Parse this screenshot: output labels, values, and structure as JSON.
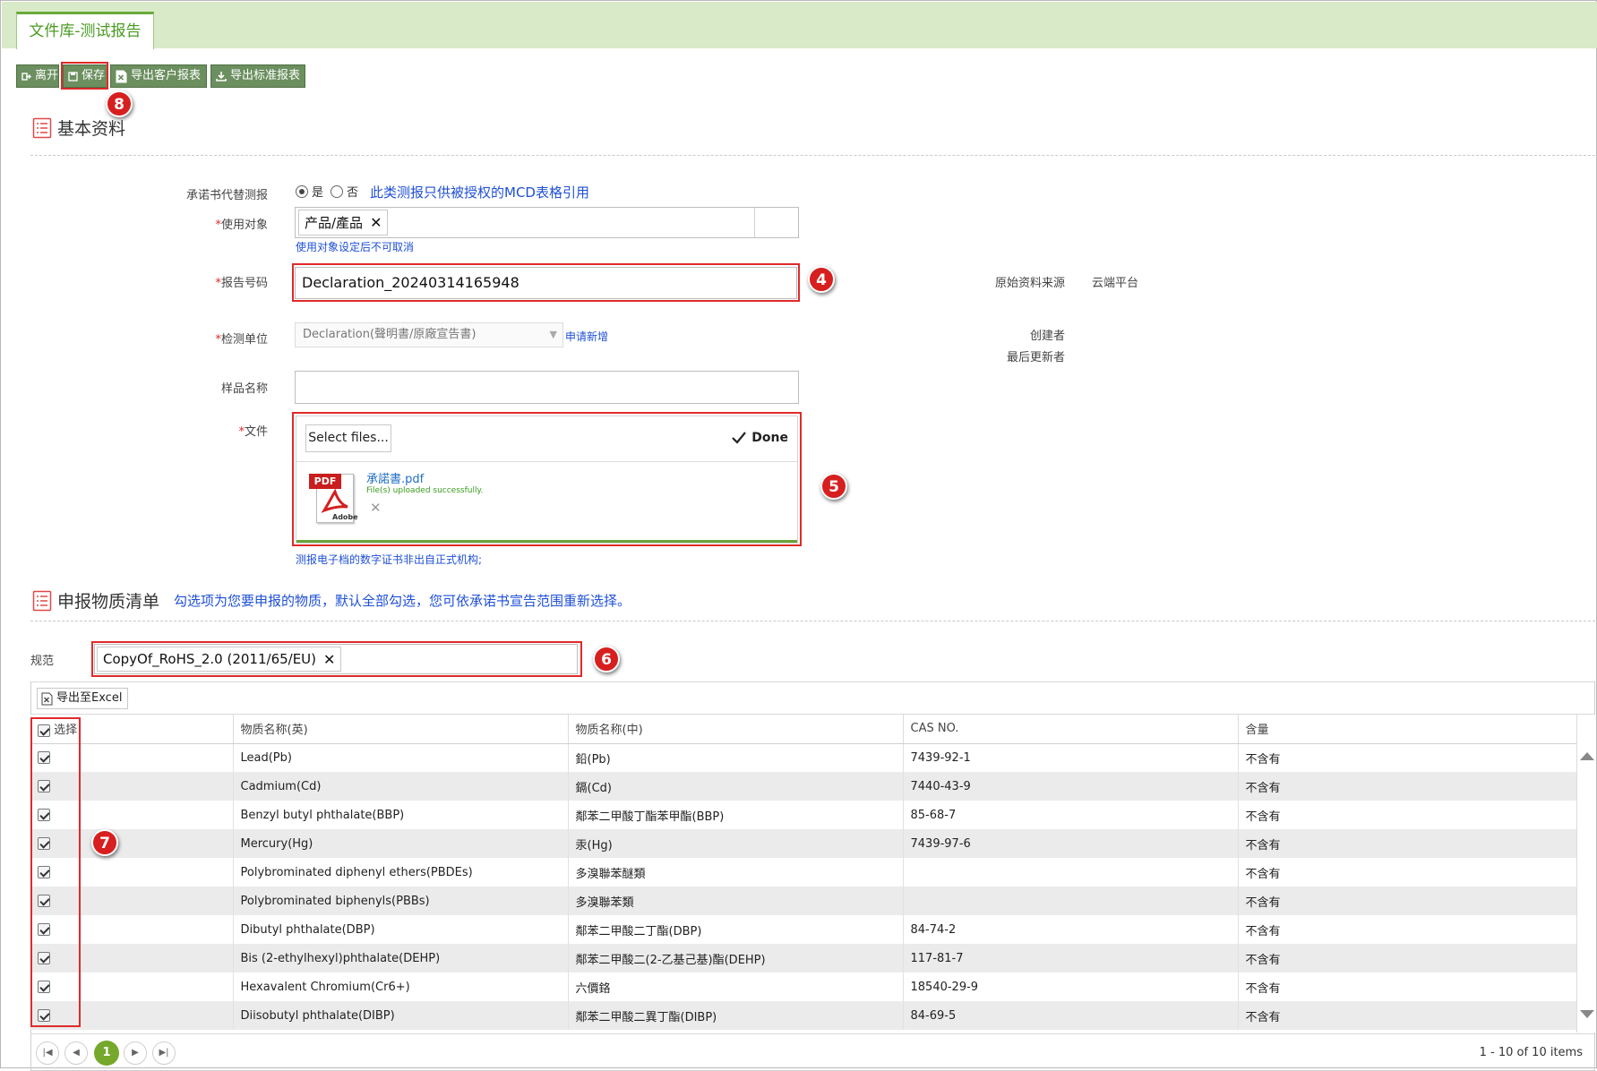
{
  "tab": {
    "title": "文件库-测试报告"
  },
  "toolbar": {
    "leave": "离开",
    "save": "保存",
    "export_customer": "导出客户报表",
    "export_standard": "导出标准报表"
  },
  "markers": {
    "m8": "8",
    "m4": "4",
    "m5": "5",
    "m6": "6",
    "m7": "7"
  },
  "section_basic": {
    "title": "基本资料"
  },
  "form": {
    "commitment_label": "承诺书代替测报",
    "radio_yes": "是",
    "radio_no": "否",
    "commitment_note": "此类测报只供被授权的MCD表格引用",
    "target_label": "使用对象",
    "target_chip": "产品/產品",
    "target_note": "使用对象设定后不可取消",
    "report_no_label": "报告号码",
    "report_no_value": "Declaration_20240314165948",
    "lab_label": "检测单位",
    "lab_value": "Declaration(聲明書/原廠宣告書)",
    "lab_apply": "申请新增",
    "sample_label": "样品名称",
    "sample_value": "",
    "file_label": "文件",
    "select_files": "Select files...",
    "done": "Done",
    "file_name": "承諾書.pdf",
    "file_status": "File(s) uploaded successfully.",
    "pdf_badge": "PDF",
    "pdf_brand": "Adobe",
    "file_note": "测报电子档的数字证书非出自正式机构;",
    "source_label": "原始资料来源",
    "source_value": "云端平台",
    "creator_label": "创建者",
    "updater_label": "最后更新者"
  },
  "section_substances": {
    "title": "申报物质清单",
    "hint": "勾选项为您要申报的物质，默认全部勾选，您可依承诺书宣告范围重新选择。"
  },
  "regulation": {
    "label": "规范",
    "chip": "CopyOf_RoHS_2.0 (2011/65/EU)"
  },
  "grid": {
    "export_excel": "导出至Excel",
    "columns": [
      "选择",
      "物质名称(英)",
      "物质名称(中)",
      "CAS NO.",
      "含量"
    ],
    "rows": [
      {
        "en": "Lead(Pb)",
        "zh": "鉛(Pb)",
        "cas": "7439-92-1",
        "content": "不含有"
      },
      {
        "en": "Cadmium(Cd)",
        "zh": "鎘(Cd)",
        "cas": "7440-43-9",
        "content": "不含有"
      },
      {
        "en": "Benzyl butyl phthalate(BBP)",
        "zh": "鄰苯二甲酸丁酯苯甲酯(BBP)",
        "cas": "85-68-7",
        "content": "不含有"
      },
      {
        "en": "Mercury(Hg)",
        "zh": "汞(Hg)",
        "cas": "7439-97-6",
        "content": "不含有"
      },
      {
        "en": "Polybrominated diphenyl ethers(PBDEs)",
        "zh": "多溴聯苯醚類",
        "cas": "",
        "content": "不含有"
      },
      {
        "en": "Polybrominated biphenyls(PBBs)",
        "zh": "多溴聯苯類",
        "cas": "",
        "content": "不含有"
      },
      {
        "en": "Dibutyl phthalate(DBP)",
        "zh": "鄰苯二甲酸二丁酯(DBP)",
        "cas": "84-74-2",
        "content": "不含有"
      },
      {
        "en": "Bis (2-ethylhexyl)phthalate(DEHP)",
        "zh": "鄰苯二甲酸二(2-乙基己基)酯(DEHP)",
        "cas": "117-81-7",
        "content": "不含有"
      },
      {
        "en": "Hexavalent Chromium(Cr6+)",
        "zh": "六價鉻",
        "cas": "18540-29-9",
        "content": "不含有"
      },
      {
        "en": "Diisobutyl phthalate(DIBP)",
        "zh": "鄰苯二甲酸二異丁酯(DIBP)",
        "cas": "84-69-5",
        "content": "不含有"
      }
    ]
  },
  "pager": {
    "current": "1",
    "summary": "1 - 10 of 10 items"
  },
  "colors": {
    "accent_green": "#6aaa3a",
    "button_green": "#6b8f5e",
    "annotation_red": "#d71f1f",
    "link_blue": "#1f50d6"
  }
}
